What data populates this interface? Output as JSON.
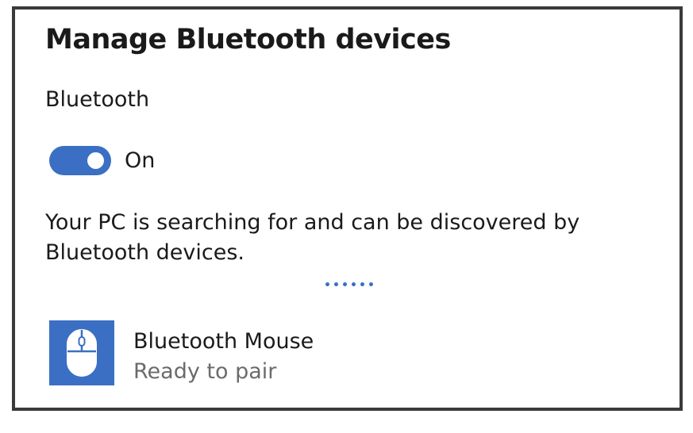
{
  "window": {
    "title": "Manage Bluetooth devices"
  },
  "bluetooth": {
    "section_label": "Bluetooth",
    "toggle_state": "On",
    "toggle_on": true,
    "status_message": "Your PC is searching for and can be discovered by Bluetooth devices.",
    "searching_indicator": "progress-dots"
  },
  "devices": [
    {
      "name": "Bluetooth Mouse",
      "status": "Ready to pair",
      "icon": "mouse-icon"
    }
  ],
  "colors": {
    "accent": "#3a6fc4",
    "border": "#3a3a3a",
    "text": "#1a1a1a",
    "secondary_text": "#6b6b6b"
  }
}
